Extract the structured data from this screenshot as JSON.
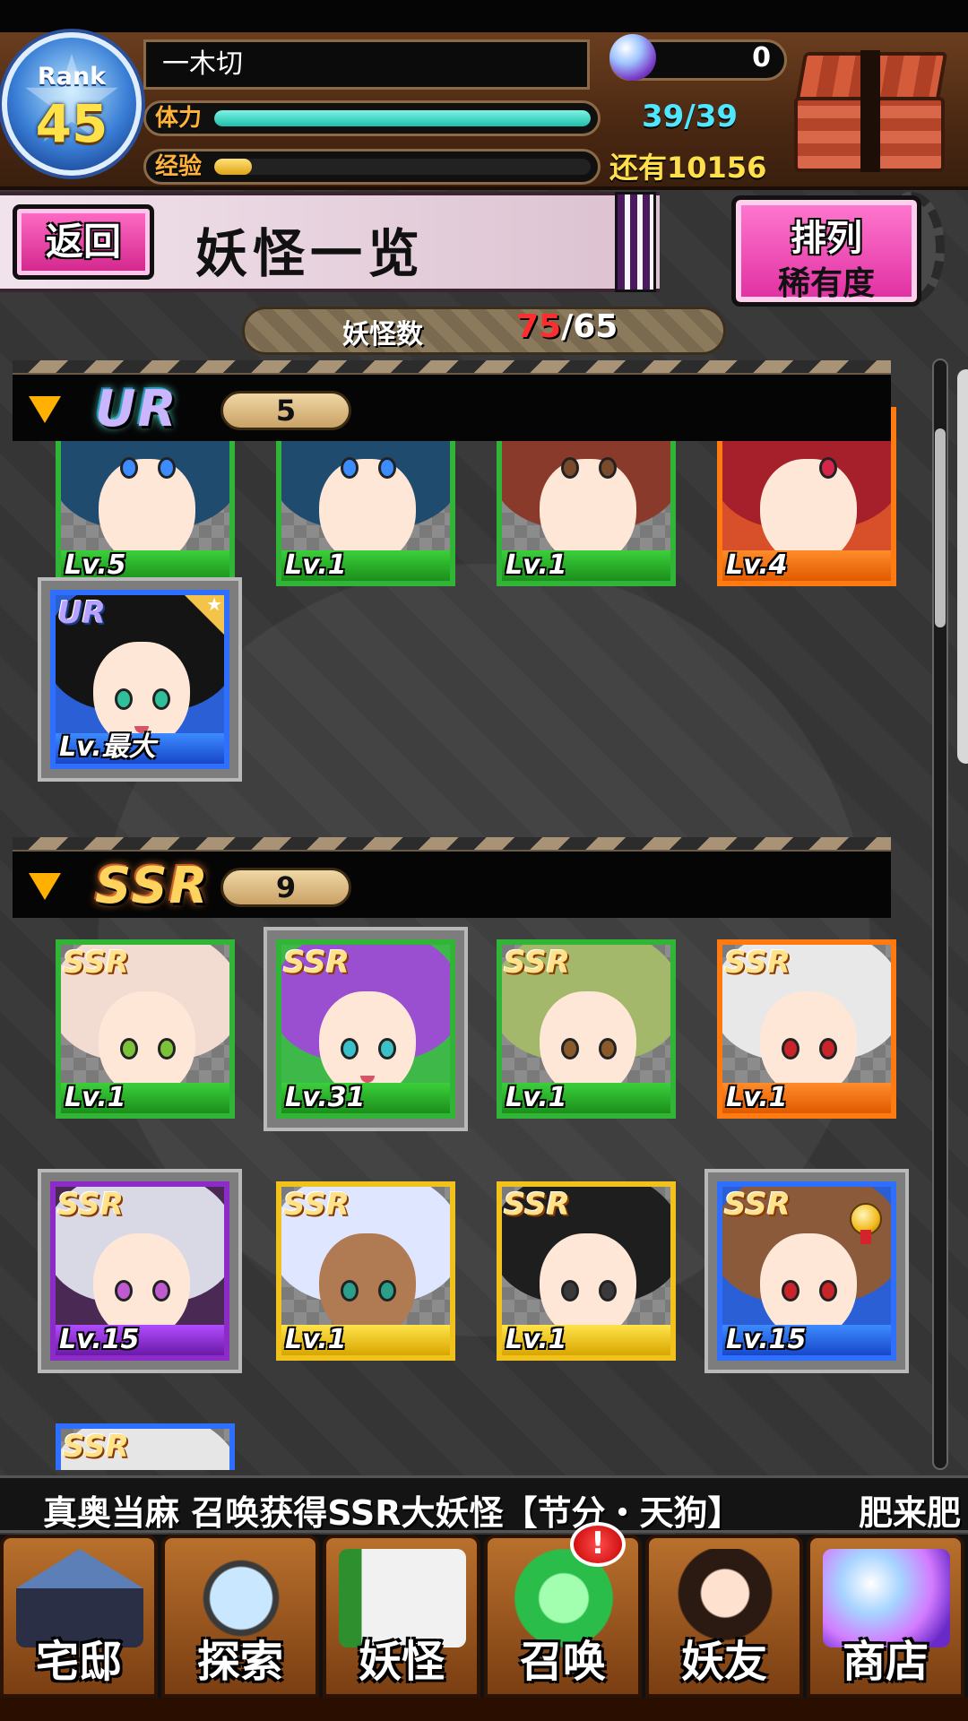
{
  "player": {
    "rank_label": "Rank",
    "rank_level": "45",
    "name": "一木切",
    "orb_count": "0",
    "stamina_label": "体力",
    "stamina_text": "39/39",
    "stamina_fraction": 1.0,
    "exp_label": "经验",
    "exp_fraction": 0.1,
    "exp_remaining": "还有10156"
  },
  "header": {
    "back_label": "返回",
    "title": "妖怪一览",
    "sort_title": "排列",
    "sort_value": "稀有度"
  },
  "monster_count": {
    "label": "妖怪数",
    "current": "75",
    "max": "/65"
  },
  "sections": [
    {
      "rarity": "UR",
      "count": "5",
      "cards": [
        {
          "level": "Lv.5"
        },
        {
          "level": "Lv.1"
        },
        {
          "level": "Lv.1"
        },
        {
          "level": "Lv.4"
        },
        {
          "level": "Lv.最大",
          "rarity": "UR"
        }
      ]
    },
    {
      "rarity": "SSR",
      "count": "9",
      "cards": [
        {
          "level": "Lv.1",
          "rarity": "SSR"
        },
        {
          "level": "Lv.31",
          "rarity": "SSR"
        },
        {
          "level": "Lv.1",
          "rarity": "SSR"
        },
        {
          "level": "Lv.1",
          "rarity": "SSR"
        },
        {
          "level": "Lv.15",
          "rarity": "SSR"
        },
        {
          "level": "Lv.1",
          "rarity": "SSR"
        },
        {
          "level": "Lv.1",
          "rarity": "SSR"
        },
        {
          "level": "Lv.15",
          "rarity": "SSR"
        },
        {
          "rarity": "SSR"
        }
      ]
    }
  ],
  "ticker": {
    "message": "真奥当麻 召唤获得SSR大妖怪【节分・天狗】",
    "tail": "肥来肥"
  },
  "nav": {
    "items": [
      {
        "label": "宅邸",
        "icon": "mansion-icon"
      },
      {
        "label": "探索",
        "icon": "magnifier-icon"
      },
      {
        "label": "妖怪",
        "icon": "monster-scroll-icon"
      },
      {
        "label": "召唤",
        "icon": "summon-star-icon"
      },
      {
        "label": "妖友",
        "icon": "friend-icon"
      },
      {
        "label": "商店",
        "icon": "crystal-ball-icon"
      }
    ],
    "notify_badge": "!"
  },
  "colors": {
    "stamina": "#1dbdaa",
    "exp": "#e0a412",
    "accent_pink": "#e02ea0",
    "count_over": "#ff2d2d"
  }
}
